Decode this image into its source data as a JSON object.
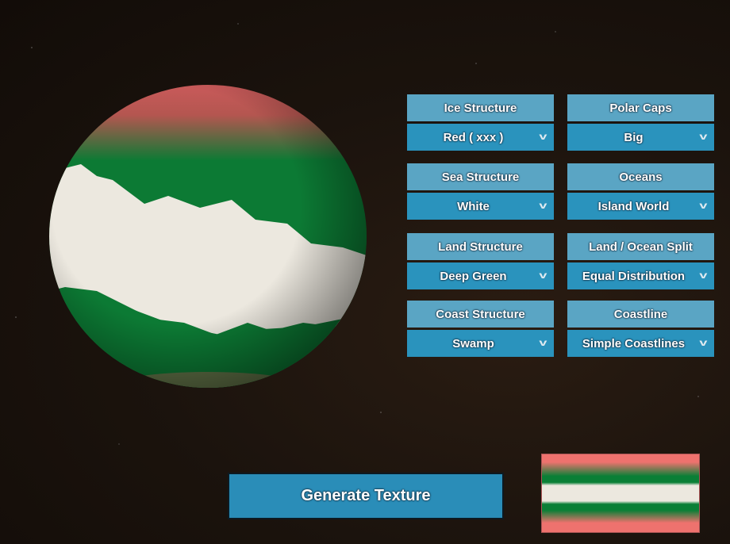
{
  "controls": [
    {
      "label": "Ice Structure",
      "value": "Red ( xxx )"
    },
    {
      "label": "Polar Caps",
      "value": "Big"
    },
    {
      "label": "Sea Structure",
      "value": "White"
    },
    {
      "label": "Oceans",
      "value": "Island World"
    },
    {
      "label": "Land Structure",
      "value": "Deep Green"
    },
    {
      "label": "Land / Ocean Split",
      "value": "Equal Distribution"
    },
    {
      "label": "Coast Structure",
      "value": "Swamp"
    },
    {
      "label": "Coastline",
      "value": "Simple Coastlines"
    }
  ],
  "generate_label": "Generate Texture",
  "colors": {
    "ice": "#ee726e",
    "land": "#0a7f36",
    "sea": "#ece8df",
    "label_bg": "#5aa5c4",
    "dropdown_bg": "#2a93bd"
  },
  "icons": {
    "dropdown": "chevron-down-icon"
  }
}
